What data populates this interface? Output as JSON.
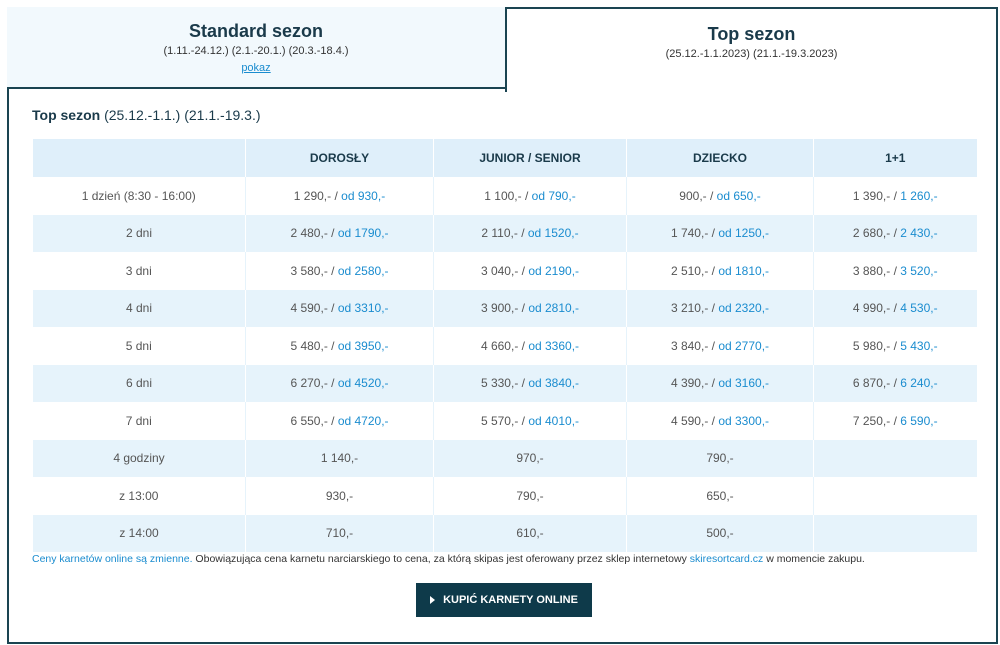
{
  "tabs": {
    "standard": {
      "title": "Standard sezon",
      "dates": "(1.11.-24.12.) (2.1.-20.1.) (20.3.-18.4.)",
      "link": "pokaz"
    },
    "top": {
      "title": "Top sezon",
      "dates": "(25.12.-1.1.2023) (21.1.-19.3.2023)"
    }
  },
  "section": {
    "title_bold": "Top sezon",
    "title_dates": " (25.12.-1.1.) (21.1.-19.3.)"
  },
  "table": {
    "headers": [
      "",
      "DOROSŁY",
      "JUNIOR / SENIOR",
      "DZIECKO",
      "1+1"
    ],
    "rows": [
      {
        "label": "1 dzień (8:30 - 16:00)",
        "cells": [
          [
            "1 290,- / ",
            "od 930,-"
          ],
          [
            "1 100,- / ",
            "od 790,-"
          ],
          [
            "900,- / ",
            "od 650,-"
          ],
          [
            "1 390,- / ",
            "1 260,-"
          ]
        ]
      },
      {
        "label": "2 dni",
        "cells": [
          [
            "2 480,- / ",
            "od 1790,-"
          ],
          [
            "2 110,- / ",
            "od 1520,-"
          ],
          [
            "1 740,- / ",
            "od 1250,-"
          ],
          [
            "2 680,- / ",
            "2 430,-"
          ]
        ]
      },
      {
        "label": "3 dni",
        "cells": [
          [
            "3 580,- / ",
            "od 2580,-"
          ],
          [
            "3 040,- / ",
            "od 2190,-"
          ],
          [
            "2 510,- / ",
            "od 1810,-"
          ],
          [
            "3 880,- / ",
            "3 520,-"
          ]
        ]
      },
      {
        "label": "4 dni",
        "cells": [
          [
            "4 590,- / ",
            "od 3310,-"
          ],
          [
            "3 900,- / ",
            "od 2810,-"
          ],
          [
            "3 210,- / ",
            "od 2320,-"
          ],
          [
            "4 990,- / ",
            "4 530,-"
          ]
        ]
      },
      {
        "label": "5 dni",
        "cells": [
          [
            "5 480,- / ",
            "od 3950,-"
          ],
          [
            "4 660,- / ",
            "od 3360,-"
          ],
          [
            "3 840,- / ",
            "od 2770,-"
          ],
          [
            "5 980,- / ",
            "5 430,-"
          ]
        ]
      },
      {
        "label": "6 dni",
        "cells": [
          [
            "6 270,- / ",
            "od 4520,-"
          ],
          [
            "5 330,- / ",
            "od 3840,-"
          ],
          [
            "4 390,- / ",
            "od 3160,-"
          ],
          [
            "6 870,- / ",
            "6 240,-"
          ]
        ]
      },
      {
        "label": "7 dni",
        "cells": [
          [
            "6 550,- / ",
            "od 4720,-"
          ],
          [
            "5 570,- / ",
            "od 4010,-"
          ],
          [
            "4 590,- / ",
            "od 3300,-"
          ],
          [
            "7 250,- / ",
            "6 590,-"
          ]
        ]
      },
      {
        "label": "4 godziny",
        "cells": [
          [
            "1 140,-",
            ""
          ],
          [
            "970,-",
            ""
          ],
          [
            "790,-",
            ""
          ],
          [
            "",
            ""
          ]
        ]
      },
      {
        "label": "z 13:00",
        "cells": [
          [
            "930,-",
            ""
          ],
          [
            "790,-",
            ""
          ],
          [
            "650,-",
            ""
          ],
          [
            "",
            ""
          ]
        ]
      },
      {
        "label": "z 14:00",
        "cells": [
          [
            "710,-",
            ""
          ],
          [
            "610,-",
            ""
          ],
          [
            "500,-",
            ""
          ],
          [
            "",
            ""
          ]
        ]
      }
    ]
  },
  "note": {
    "link1": "Ceny karnetów online są zmienne.",
    "text1": " Obowiązująca cena karnetu narciarskiego to cena, za którą skipas jest oferowany przez sklep internetowy ",
    "link2": "skiresortcard.cz",
    "text2": " w momencie zakupu."
  },
  "buy_button": {
    "label": "KUPIĆ KARNETY ONLINE",
    "icon": "play-arrow-icon"
  },
  "colors": {
    "accent": "#1a8ccf",
    "dark": "#0e3a4a",
    "border": "#1a4451",
    "row_alt": "#e6f3fb"
  }
}
